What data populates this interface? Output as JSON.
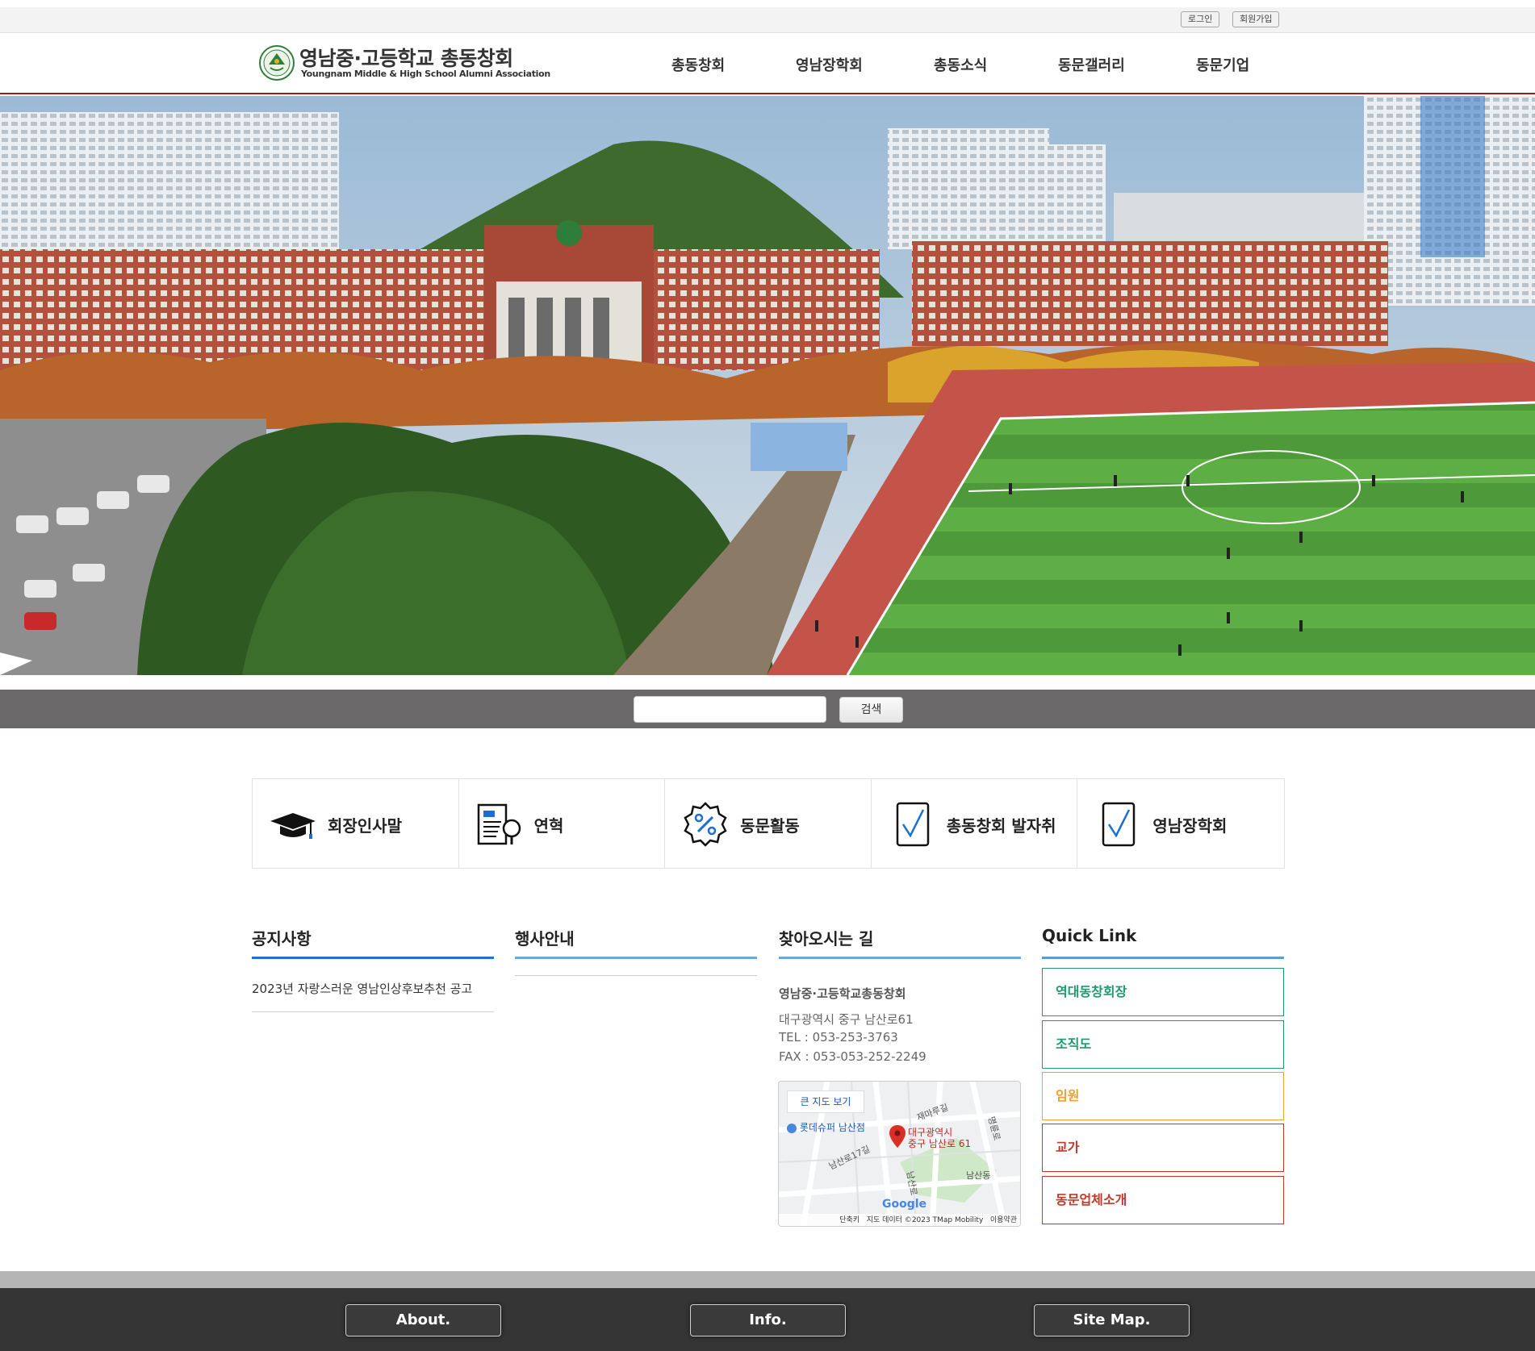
{
  "util": {
    "login": "로그인",
    "signup": "회원가입"
  },
  "brand": {
    "name_ko": "영남중·고등학교 총동창회",
    "name_en": "Youngnam Middle & High School Alumni Association",
    "accent": "#9b1b1b"
  },
  "nav": [
    "총동창회",
    "영남장학회",
    "총동소식",
    "동문갤러리",
    "동문기업"
  ],
  "search": {
    "placeholder": "",
    "button": "검색"
  },
  "icon_menu": [
    {
      "label": "회장인사말",
      "icon": "graduation-cap-icon"
    },
    {
      "label": "연혁",
      "icon": "document-magnifier-icon"
    },
    {
      "label": "동문활동",
      "icon": "percent-badge-icon"
    },
    {
      "label": "총동창회 발자취",
      "icon": "clipboard-check-icon"
    },
    {
      "label": "영남장학회",
      "icon": "clipboard-check-icon"
    }
  ],
  "notice": {
    "title": "공지사항",
    "items": [
      "2023년 자랑스러운 영남인상후보추천 공고"
    ]
  },
  "events": {
    "title": "행사안내"
  },
  "directions": {
    "title": "찾아오시는 길",
    "name": "영남중·고등학교총동창회",
    "address": "대구광역시 중구 남산로61",
    "tel": "TEL : 053-253-3763",
    "fax": "FAX : 053-053-252-2249",
    "map": {
      "big_map_button": "큰 지도 보기",
      "marker_line1": "대구광역시",
      "marker_line2": "중구 남산로 61",
      "place_label": "롯데슈퍼 남산점",
      "street_labels": [
        "재마루길",
        "남산로",
        "남산동",
        "명륜로",
        "남산로17길"
      ],
      "logo": "Google",
      "attribution": "단축키   지도 데이터 ©2023 TMap Mobility   이용약관"
    }
  },
  "quick_link": {
    "title": "Quick Link",
    "items": [
      {
        "label": "역대동창회장",
        "color": "#1f9a6e"
      },
      {
        "label": "조직도",
        "color": "#1f9a6e"
      },
      {
        "label": "임원",
        "color": "#f0a030"
      },
      {
        "label": "교가",
        "color": "#c0392b"
      },
      {
        "label": "동문업체소개",
        "color": "#c0392b"
      }
    ]
  },
  "footer": [
    "About.",
    "Info.",
    "Site Map."
  ]
}
